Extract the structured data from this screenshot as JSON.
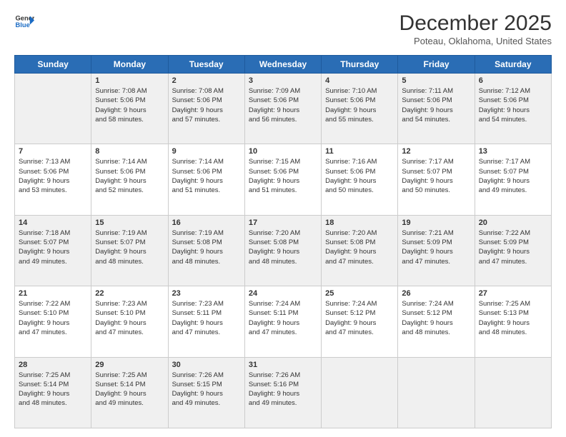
{
  "logo": {
    "line1": "General",
    "line2": "Blue"
  },
  "title": "December 2025",
  "location": "Poteau, Oklahoma, United States",
  "weekdays": [
    "Sunday",
    "Monday",
    "Tuesday",
    "Wednesday",
    "Thursday",
    "Friday",
    "Saturday"
  ],
  "weeks": [
    [
      {
        "day": "",
        "lines": []
      },
      {
        "day": "1",
        "lines": [
          "Sunrise: 7:08 AM",
          "Sunset: 5:06 PM",
          "Daylight: 9 hours",
          "and 58 minutes."
        ]
      },
      {
        "day": "2",
        "lines": [
          "Sunrise: 7:08 AM",
          "Sunset: 5:06 PM",
          "Daylight: 9 hours",
          "and 57 minutes."
        ]
      },
      {
        "day": "3",
        "lines": [
          "Sunrise: 7:09 AM",
          "Sunset: 5:06 PM",
          "Daylight: 9 hours",
          "and 56 minutes."
        ]
      },
      {
        "day": "4",
        "lines": [
          "Sunrise: 7:10 AM",
          "Sunset: 5:06 PM",
          "Daylight: 9 hours",
          "and 55 minutes."
        ]
      },
      {
        "day": "5",
        "lines": [
          "Sunrise: 7:11 AM",
          "Sunset: 5:06 PM",
          "Daylight: 9 hours",
          "and 54 minutes."
        ]
      },
      {
        "day": "6",
        "lines": [
          "Sunrise: 7:12 AM",
          "Sunset: 5:06 PM",
          "Daylight: 9 hours",
          "and 54 minutes."
        ]
      }
    ],
    [
      {
        "day": "7",
        "lines": [
          "Sunrise: 7:13 AM",
          "Sunset: 5:06 PM",
          "Daylight: 9 hours",
          "and 53 minutes."
        ]
      },
      {
        "day": "8",
        "lines": [
          "Sunrise: 7:14 AM",
          "Sunset: 5:06 PM",
          "Daylight: 9 hours",
          "and 52 minutes."
        ]
      },
      {
        "day": "9",
        "lines": [
          "Sunrise: 7:14 AM",
          "Sunset: 5:06 PM",
          "Daylight: 9 hours",
          "and 51 minutes."
        ]
      },
      {
        "day": "10",
        "lines": [
          "Sunrise: 7:15 AM",
          "Sunset: 5:06 PM",
          "Daylight: 9 hours",
          "and 51 minutes."
        ]
      },
      {
        "day": "11",
        "lines": [
          "Sunrise: 7:16 AM",
          "Sunset: 5:06 PM",
          "Daylight: 9 hours",
          "and 50 minutes."
        ]
      },
      {
        "day": "12",
        "lines": [
          "Sunrise: 7:17 AM",
          "Sunset: 5:07 PM",
          "Daylight: 9 hours",
          "and 50 minutes."
        ]
      },
      {
        "day": "13",
        "lines": [
          "Sunrise: 7:17 AM",
          "Sunset: 5:07 PM",
          "Daylight: 9 hours",
          "and 49 minutes."
        ]
      }
    ],
    [
      {
        "day": "14",
        "lines": [
          "Sunrise: 7:18 AM",
          "Sunset: 5:07 PM",
          "Daylight: 9 hours",
          "and 49 minutes."
        ]
      },
      {
        "day": "15",
        "lines": [
          "Sunrise: 7:19 AM",
          "Sunset: 5:07 PM",
          "Daylight: 9 hours",
          "and 48 minutes."
        ]
      },
      {
        "day": "16",
        "lines": [
          "Sunrise: 7:19 AM",
          "Sunset: 5:08 PM",
          "Daylight: 9 hours",
          "and 48 minutes."
        ]
      },
      {
        "day": "17",
        "lines": [
          "Sunrise: 7:20 AM",
          "Sunset: 5:08 PM",
          "Daylight: 9 hours",
          "and 48 minutes."
        ]
      },
      {
        "day": "18",
        "lines": [
          "Sunrise: 7:20 AM",
          "Sunset: 5:08 PM",
          "Daylight: 9 hours",
          "and 47 minutes."
        ]
      },
      {
        "day": "19",
        "lines": [
          "Sunrise: 7:21 AM",
          "Sunset: 5:09 PM",
          "Daylight: 9 hours",
          "and 47 minutes."
        ]
      },
      {
        "day": "20",
        "lines": [
          "Sunrise: 7:22 AM",
          "Sunset: 5:09 PM",
          "Daylight: 9 hours",
          "and 47 minutes."
        ]
      }
    ],
    [
      {
        "day": "21",
        "lines": [
          "Sunrise: 7:22 AM",
          "Sunset: 5:10 PM",
          "Daylight: 9 hours",
          "and 47 minutes."
        ]
      },
      {
        "day": "22",
        "lines": [
          "Sunrise: 7:23 AM",
          "Sunset: 5:10 PM",
          "Daylight: 9 hours",
          "and 47 minutes."
        ]
      },
      {
        "day": "23",
        "lines": [
          "Sunrise: 7:23 AM",
          "Sunset: 5:11 PM",
          "Daylight: 9 hours",
          "and 47 minutes."
        ]
      },
      {
        "day": "24",
        "lines": [
          "Sunrise: 7:24 AM",
          "Sunset: 5:11 PM",
          "Daylight: 9 hours",
          "and 47 minutes."
        ]
      },
      {
        "day": "25",
        "lines": [
          "Sunrise: 7:24 AM",
          "Sunset: 5:12 PM",
          "Daylight: 9 hours",
          "and 47 minutes."
        ]
      },
      {
        "day": "26",
        "lines": [
          "Sunrise: 7:24 AM",
          "Sunset: 5:12 PM",
          "Daylight: 9 hours",
          "and 48 minutes."
        ]
      },
      {
        "day": "27",
        "lines": [
          "Sunrise: 7:25 AM",
          "Sunset: 5:13 PM",
          "Daylight: 9 hours",
          "and 48 minutes."
        ]
      }
    ],
    [
      {
        "day": "28",
        "lines": [
          "Sunrise: 7:25 AM",
          "Sunset: 5:14 PM",
          "Daylight: 9 hours",
          "and 48 minutes."
        ]
      },
      {
        "day": "29",
        "lines": [
          "Sunrise: 7:25 AM",
          "Sunset: 5:14 PM",
          "Daylight: 9 hours",
          "and 49 minutes."
        ]
      },
      {
        "day": "30",
        "lines": [
          "Sunrise: 7:26 AM",
          "Sunset: 5:15 PM",
          "Daylight: 9 hours",
          "and 49 minutes."
        ]
      },
      {
        "day": "31",
        "lines": [
          "Sunrise: 7:26 AM",
          "Sunset: 5:16 PM",
          "Daylight: 9 hours",
          "and 49 minutes."
        ]
      },
      {
        "day": "",
        "lines": []
      },
      {
        "day": "",
        "lines": []
      },
      {
        "day": "",
        "lines": []
      }
    ]
  ]
}
